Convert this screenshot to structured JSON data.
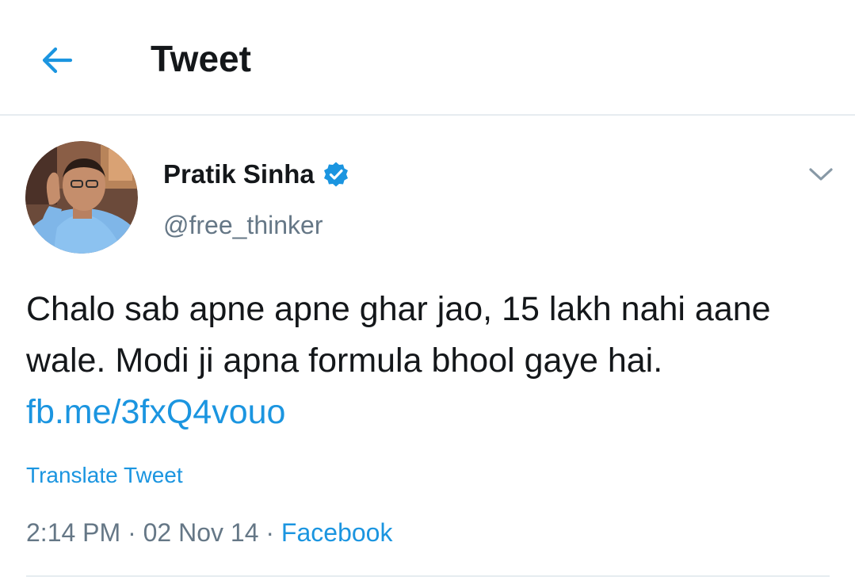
{
  "header": {
    "back_icon": "arrow-left-icon",
    "title": "Tweet"
  },
  "author": {
    "name": "Pratik Sinha",
    "verified_icon": "verified-badge-icon",
    "handle": "@free_thinker",
    "menu_icon": "chevron-down-icon"
  },
  "tweet": {
    "text": "Chalo sab apne apne ghar jao, 15 lakh nahi aane wale. Modi ji apna formula bhool gaye hai.",
    "link": "fb.me/3fxQ4vouo",
    "translate_label": "Translate Tweet",
    "time": "2:14 PM",
    "separator": "·",
    "date": "02 Nov 14",
    "source": "Facebook"
  },
  "colors": {
    "accent": "#1b95e0",
    "text": "#14171a",
    "secondary": "#657786",
    "divider": "#e6ecf0"
  }
}
